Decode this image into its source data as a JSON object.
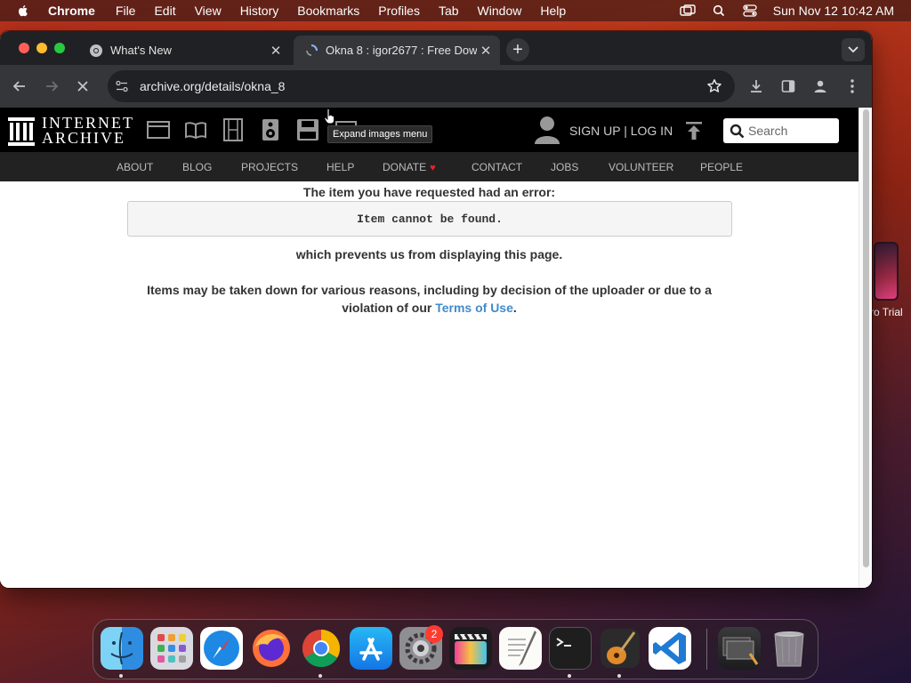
{
  "menubar": {
    "app_name": "Chrome",
    "items": [
      "File",
      "Edit",
      "View",
      "History",
      "Bookmarks",
      "Profiles",
      "Tab",
      "Window",
      "Help"
    ],
    "clock": "Sun Nov 12  10:42 AM"
  },
  "desktop": {
    "partial_label": "ro Trial"
  },
  "browser": {
    "tabs": [
      {
        "title": "What's New",
        "active": false
      },
      {
        "title": "Okna 8 : igor2677 : Free Dow",
        "active": true
      }
    ],
    "url": "archive.org/details/okna_8"
  },
  "ia": {
    "logo_line1": "INTERNET",
    "logo_line2": "ARCHIVE",
    "tooltip": "Expand images menu",
    "auth": "SIGN UP | LOG IN",
    "search_placeholder": "Search",
    "nav": [
      "ABOUT",
      "BLOG",
      "PROJECTS",
      "HELP",
      "DONATE",
      "CONTACT",
      "JOBS",
      "VOLUNTEER",
      "PEOPLE"
    ],
    "donate_heart": "♥"
  },
  "content": {
    "error_heading": "The item you have requested had an error:",
    "error_message": "Item cannot be found.",
    "prevents": "which prevents us from displaying this page.",
    "takedown_line1": "Items may be taken down for various reasons, including by decision of the uploader or due to a",
    "takedown_line2_prefix": "violation of our",
    "tos_link": "Terms of Use",
    "takedown_line2_suffix": "."
  },
  "dock": {
    "apps": [
      "finder-icon",
      "launchpad-icon",
      "safari-icon",
      "firefox-icon",
      "chrome-icon",
      "app-store-icon",
      "system-settings-icon",
      "final-cut-pro-icon",
      "textedit-icon",
      "terminal-icon",
      "garageband-icon",
      "vscode-icon",
      "downloads-stack-icon",
      "trash-icon"
    ],
    "settings_badge": "2"
  },
  "colors": {
    "ia_black": "#000000",
    "ia_nav": "#222222",
    "link_blue": "#428bca",
    "donate_red": "#e8232c"
  }
}
